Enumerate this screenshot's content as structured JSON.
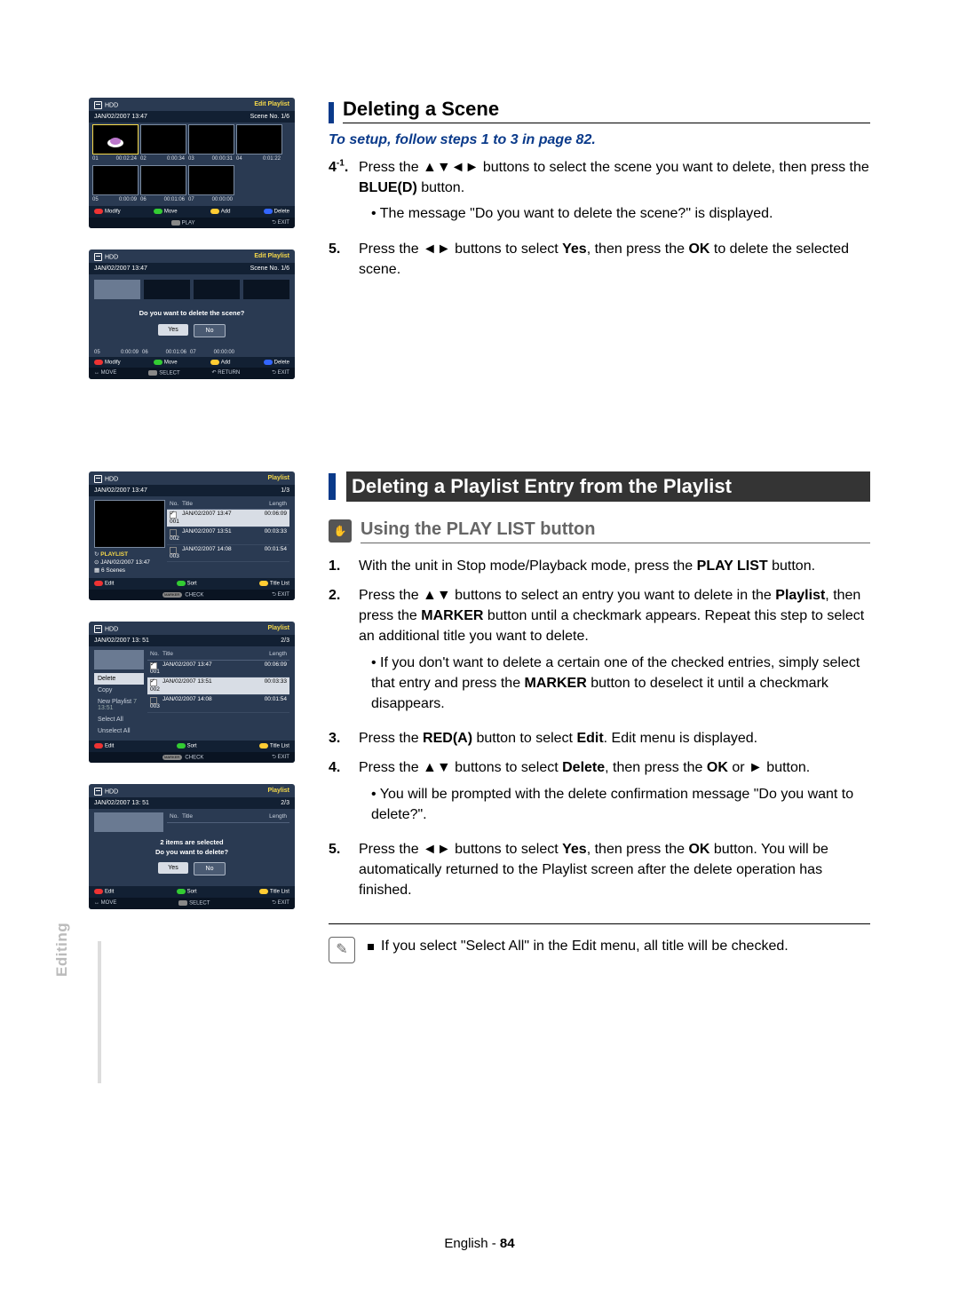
{
  "sidebar_label": "Editing",
  "section1": {
    "title": "Deleting a Scene",
    "setup_note": "To setup, follow steps 1 to 3 in page 82.",
    "step4_num": "4",
    "step4_sup": "-1",
    "step4_dot": ".",
    "step4_a": "Press the ",
    "step4_b": " buttons to select the scene you want to delete, then press the ",
    "step4_blue": "BLUE(D)",
    "step4_c": " button.",
    "step4_bullet": "The message \"Do you want to delete the scene?\" is displayed.",
    "step5_num": "5.",
    "step5_a": "Press the ",
    "step5_b": " buttons to select ",
    "step5_yes": "Yes",
    "step5_c": ", then press the ",
    "step5_ok": "OK",
    "step5_d": " to delete the selected scene."
  },
  "section2": {
    "title": "Deleting a Playlist Entry from the Playlist",
    "subtitle": "Using the PLAY LIST button",
    "s1_num": "1.",
    "s1_a": "With the unit in Stop mode/Playback mode, press the ",
    "s1_btn": "PLAY LIST",
    "s1_b": " button.",
    "s2_num": "2.",
    "s2_a": "Press the ",
    "s2_b": " buttons to select an entry you want to delete in the ",
    "s2_pl": "Playlist",
    "s2_c": ", then press the ",
    "s2_mk": "MARKER",
    "s2_d": " button until a checkmark appears. Repeat this step to select an additional title you want to delete.",
    "s2_bullet_a": "If you don't want to delete a certain one of the checked entries, simply select that entry and press the ",
    "s2_bullet_mk": "MARKER",
    "s2_bullet_b": " button to deselect it until a checkmark disappears.",
    "s3_num": "3.",
    "s3_a": "Press the ",
    "s3_red": "RED(A)",
    "s3_b": " button to select ",
    "s3_edit": "Edit",
    "s3_c": ". Edit menu is displayed.",
    "s4_num": "4.",
    "s4_a": "Press the ",
    "s4_b": " buttons to select ",
    "s4_del": "Delete",
    "s4_c": ", then press the ",
    "s4_ok": "OK",
    "s4_d": " or ",
    "s4_e": " button.",
    "s4_bullet": "You will be prompted with the delete confirmation message \"Do you want to delete?\".",
    "s5_num": "5.",
    "s5_a": "Press the ",
    "s5_b": " buttons to select ",
    "s5_yes": "Yes",
    "s5_c": ", then press the ",
    "s5_ok": "OK",
    "s5_d": " button. You will be automatically returned to the Playlist screen after the delete operation has finished.",
    "note": "If you select \"Select All\" in the Edit menu, all title will be checked."
  },
  "arrows": {
    "udlr": "▲▼◄►",
    "lr": "◄►",
    "ud": "▲▼",
    "r": "►"
  },
  "osd1": {
    "hdd": "HDD",
    "right": "Edit Playlist",
    "date": "JAN/02/2007 13:47",
    "scene": "Scene No. 1/6",
    "cells": [
      {
        "n": "01",
        "t": "00:02:24"
      },
      {
        "n": "02",
        "t": "0:00:34"
      },
      {
        "n": "03",
        "t": "00:00:31"
      },
      {
        "n": "04",
        "t": "0:01:22"
      },
      {
        "n": "05",
        "t": "0:00:09"
      },
      {
        "n": "06",
        "t": "00:01:06"
      },
      {
        "n": "07",
        "t": "00:00:00"
      }
    ],
    "f_modify": "Modify",
    "f_move": "Move",
    "f_add": "Add",
    "f_delete": "Delete",
    "f2_play": "PLAY",
    "f2_exit": "EXIT"
  },
  "osd2": {
    "hdd": "HDD",
    "right": "Edit Playlist",
    "date": "JAN/02/2007 13:47",
    "scene": "Scene No. 1/6",
    "msg": "Do you want to delete the scene?",
    "yes": "Yes",
    "no": "No",
    "cells": [
      {
        "n": "05",
        "t": "0:00:09"
      },
      {
        "n": "06",
        "t": "00:01:06"
      },
      {
        "n": "07",
        "t": "00:00:00"
      }
    ],
    "f_modify": "Modify",
    "f_move": "Move",
    "f_add": "Add",
    "f_delete": "Delete",
    "f2_move": "MOVE",
    "f2_select": "SELECT",
    "f2_return": "RETURN",
    "f2_exit": "EXIT"
  },
  "osd3": {
    "hdd": "HDD",
    "right": "Playlist",
    "date": "JAN/02/2007 13:47",
    "page": "1/3",
    "h_no": "No.",
    "h_title": "Title",
    "h_len": "Length",
    "rows": [
      {
        "n": "001",
        "t": "JAN/02/2007 13:47",
        "l": "00:06:09"
      },
      {
        "n": "002",
        "t": "JAN/02/2007 13:51",
        "l": "00:03:33"
      },
      {
        "n": "003",
        "t": "JAN/02/2007 14:08",
        "l": "00:01:54"
      }
    ],
    "left_name": "PLAYLIST",
    "left_date": "JAN/02/2007 13:47",
    "left_scenes": "6 Scenes",
    "f_edit": "Edit",
    "f_sort": "Sort",
    "f_go": "Title List",
    "f2_check": "CHECK",
    "f2_exit": "EXIT",
    "f2_marker": "MARKER"
  },
  "osd4": {
    "hdd": "HDD",
    "right": "Playlist",
    "date": "JAN/02/2007 13: 51",
    "page": "2/3",
    "h_no": "No.",
    "h_title": "Title",
    "h_len": "Length",
    "rows": [
      {
        "n": "001",
        "t": "JAN/02/2007 13:47",
        "l": "00:06:09"
      },
      {
        "n": "002",
        "t": "JAN/02/2007 13:51",
        "l": "00:03:33"
      },
      {
        "n": "003",
        "t": "JAN/02/2007 14:08",
        "l": "00:01:54"
      }
    ],
    "menu": [
      "Delete",
      "Copy",
      "New Playlist",
      "Select All",
      "Unselect All"
    ],
    "menu_time": "7 13:51",
    "f_edit": "Edit",
    "f_sort": "Sort",
    "f_go": "Title List",
    "f2_check": "CHECK",
    "f2_exit": "EXIT",
    "f2_marker": "MARKER"
  },
  "osd5": {
    "hdd": "HDD",
    "right": "Playlist",
    "date": "JAN/02/2007 13: 51",
    "page": "2/3",
    "h_no": "No.",
    "h_title": "Title",
    "h_len": "Length",
    "msg1": "2 items are selected",
    "msg2": "Do you want to delete?",
    "yes": "Yes",
    "no": "No",
    "f_edit": "Edit",
    "f_sort": "Sort",
    "f_go": "Title List",
    "f2_move": "MOVE",
    "f2_select": "SELECT",
    "f2_exit": "EXIT"
  },
  "footer_lang": "English",
  "footer_dash": " - ",
  "footer_page": "84"
}
